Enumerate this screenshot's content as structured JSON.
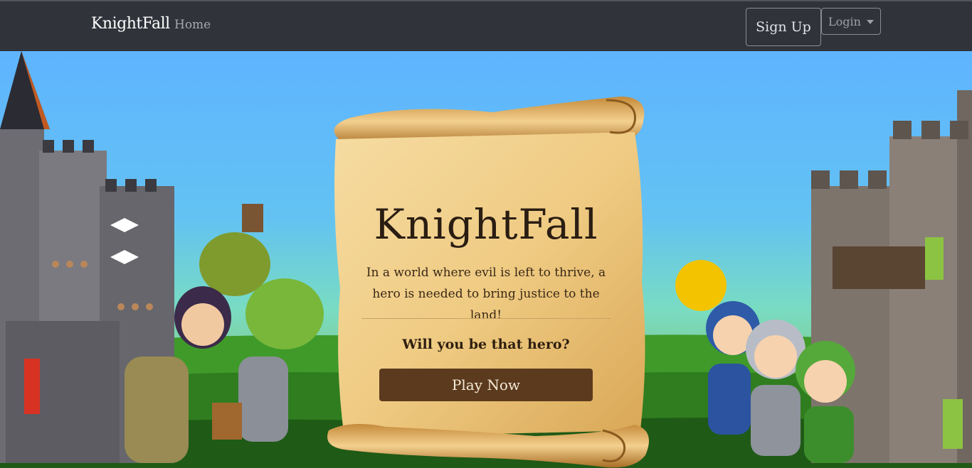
{
  "nav": {
    "brand": "KnightFall",
    "home": "Home",
    "signup": "Sign Up",
    "login": "Login"
  },
  "hero": {
    "title": "KnightFall",
    "lead": "In a world where evil is left to thrive, a hero is needed to bring justice to the land!",
    "question": "Will you be that hero?",
    "cta": "Play Now"
  },
  "colors": {
    "navbar": "#30333a",
    "sky": "#5fb4ff",
    "parchment": "#f0cf8c",
    "button": "#5b3a1e"
  }
}
